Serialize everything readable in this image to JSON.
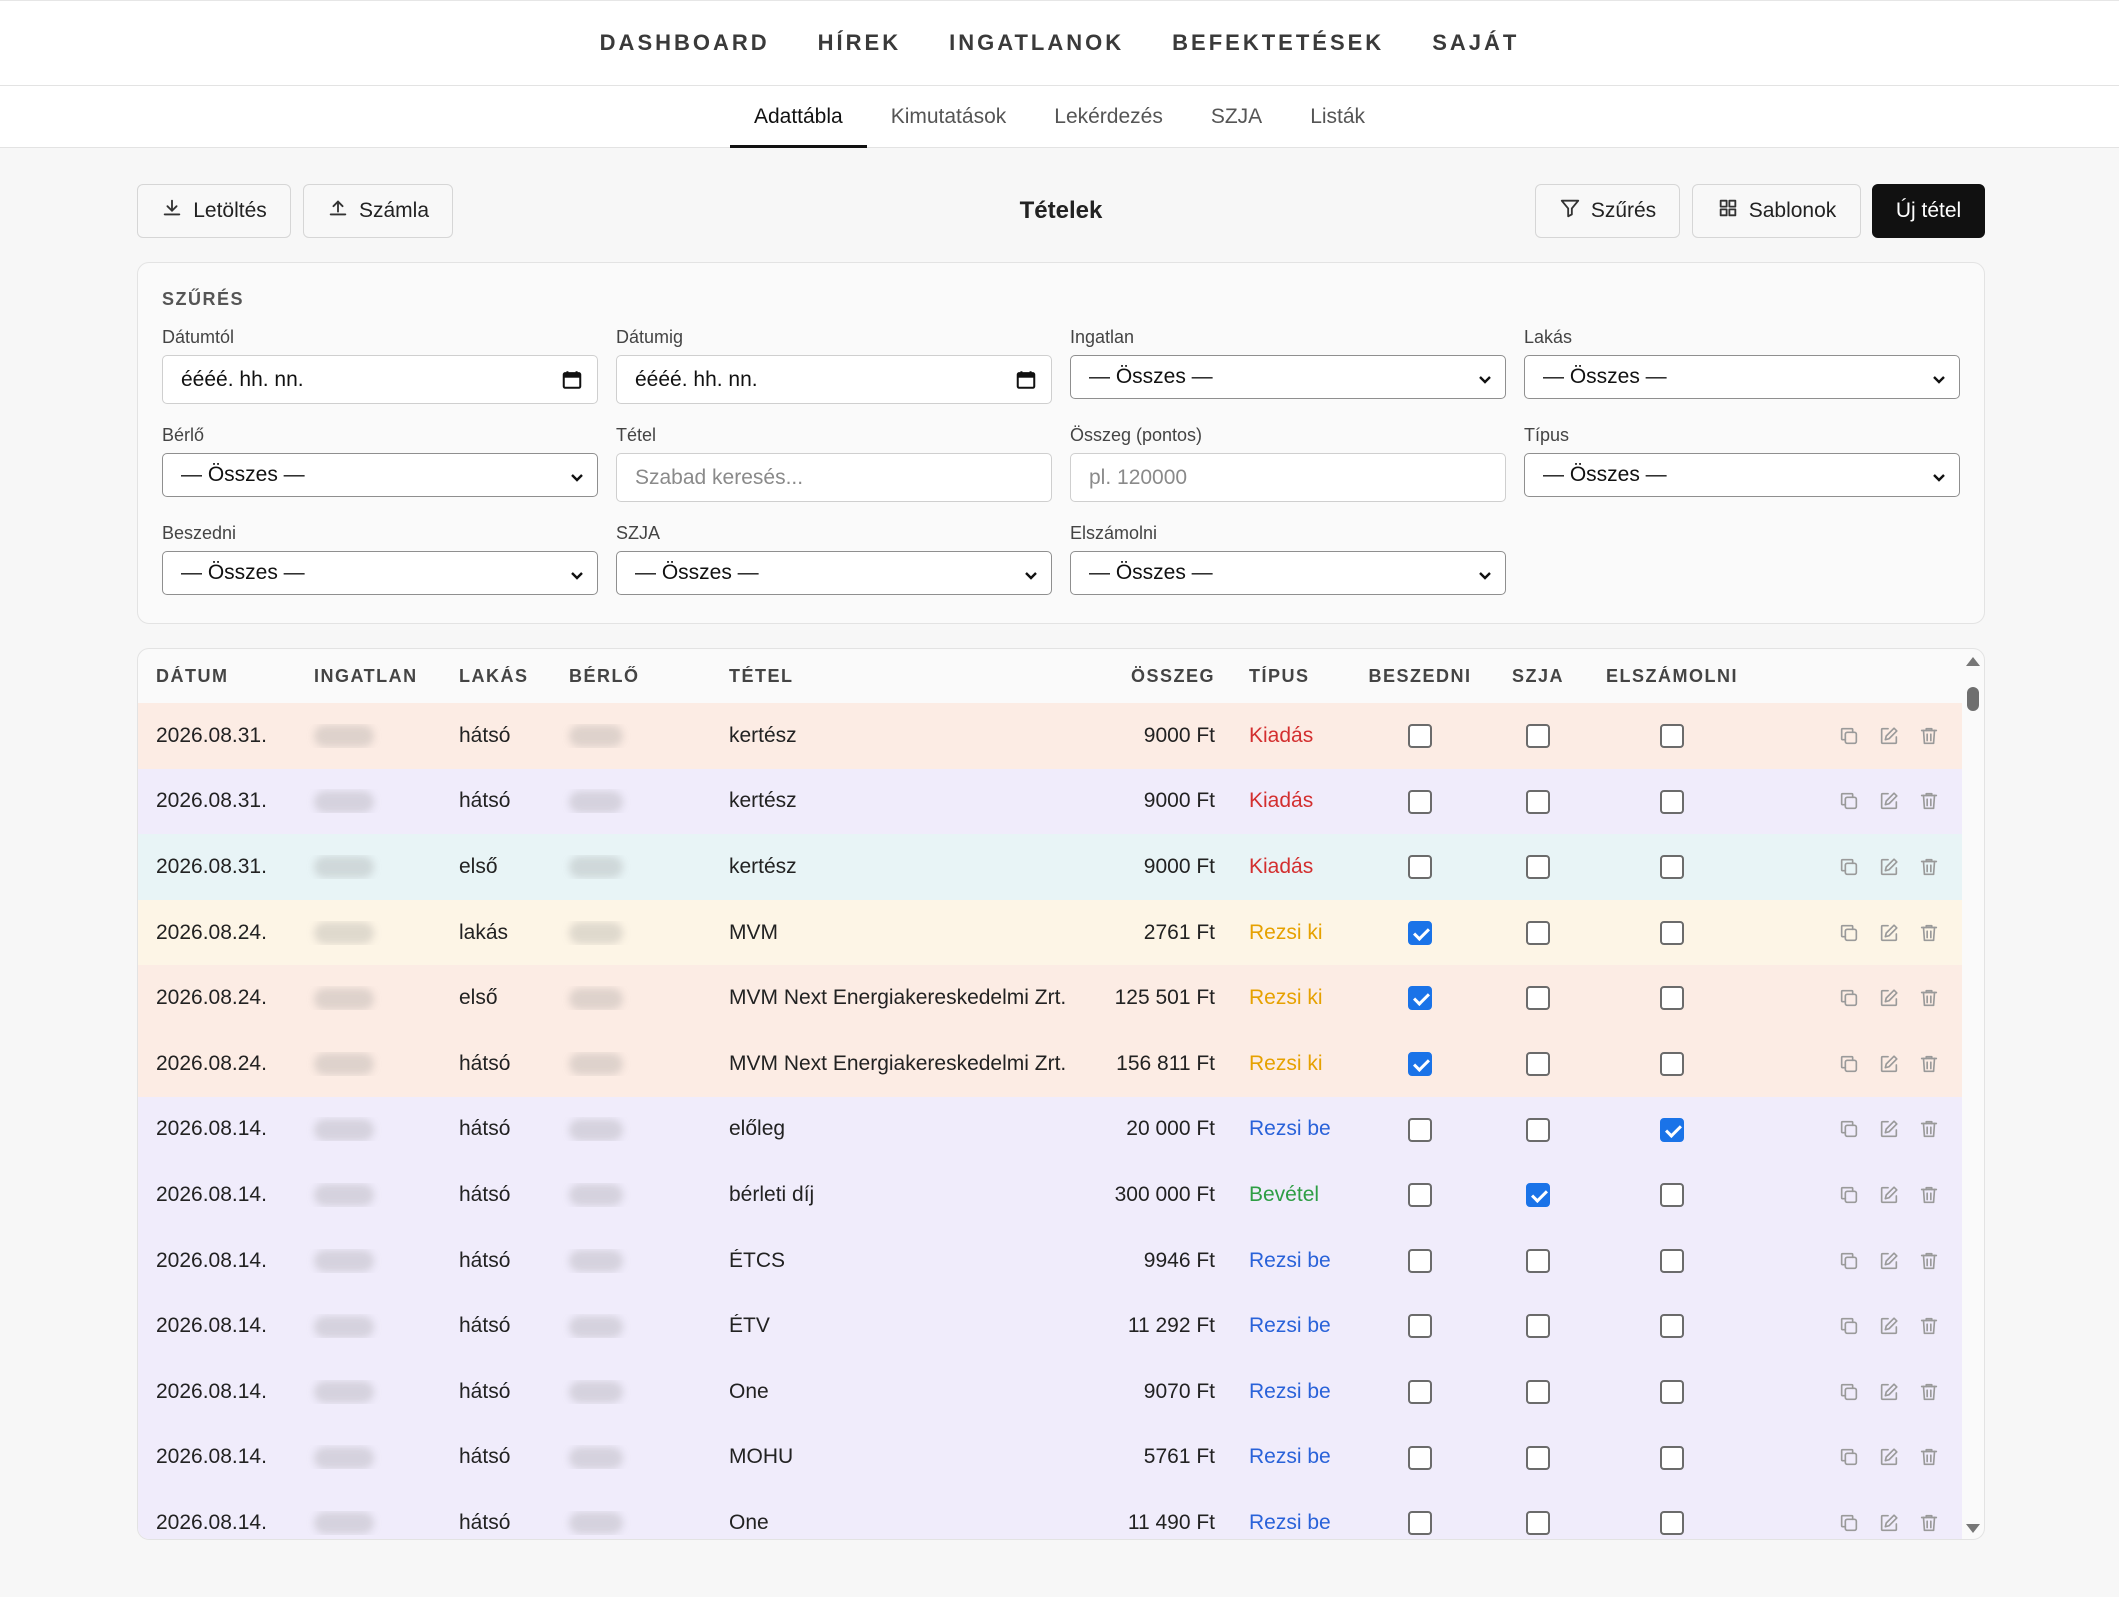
{
  "topnav": [
    "DASHBOARD",
    "HÍREK",
    "INGATLANOK",
    "BEFEKTETÉSEK",
    "SAJÁT"
  ],
  "subtabs": [
    "Adattábla",
    "Kimutatások",
    "Lekérdezés",
    "SZJA",
    "Listák"
  ],
  "active_subtab": "Adattábla",
  "toolbar": {
    "download": "Letöltés",
    "invoice": "Számla",
    "title": "Tételek",
    "filter": "Szűrés",
    "templates": "Sablonok",
    "new_item": "Új tétel"
  },
  "filters": {
    "heading": "SZŰRÉS",
    "fields": [
      {
        "label": "Dátumtól",
        "value": "éééé. hh. nn.",
        "kind": "date"
      },
      {
        "label": "Dátumig",
        "value": "éééé. hh. nn.",
        "kind": "date"
      },
      {
        "label": "Ingatlan",
        "value": "— Összes —",
        "kind": "select"
      },
      {
        "label": "Lakás",
        "value": "— Összes —",
        "kind": "select"
      },
      {
        "label": "Bérlő",
        "value": "— Összes —",
        "kind": "select"
      },
      {
        "label": "Tétel",
        "placeholder": "Szabad keresés...",
        "kind": "text"
      },
      {
        "label": "Összeg (pontos)",
        "placeholder": "pl. 120000",
        "kind": "text"
      },
      {
        "label": "Típus",
        "value": "— Összes —",
        "kind": "select"
      },
      {
        "label": "Beszedni",
        "value": "— Összes —",
        "kind": "select"
      },
      {
        "label": "SZJA",
        "value": "— Összes —",
        "kind": "select"
      },
      {
        "label": "Elszámolni",
        "value": "— Összes —",
        "kind": "select"
      }
    ]
  },
  "table": {
    "columns": [
      "DÁTUM",
      "INGATLAN",
      "LAKÁS",
      "BÉRLŐ",
      "TÉTEL",
      "ÖSSZEG",
      "TÍPUS",
      "BESZEDNI",
      "SZJA",
      "ELSZÁMOLNI"
    ],
    "type_colors": {
      "Kiadás": "#d32f2f",
      "Rezsi ki": "#e6a100",
      "Rezsi be": "#2962d9",
      "Bevétel": "#2e9e44"
    },
    "row_colors": {
      "peach": "#fcece4",
      "lavender": "#f0ecfb",
      "cyan": "#e8f4f6",
      "cream": "#fdf5e6"
    },
    "rows": [
      {
        "date": "2026.08.31.",
        "unit": "hátsó",
        "item": "kertész",
        "amount": "9000 Ft",
        "type": "Kiadás",
        "beszedni": false,
        "szja": false,
        "elszamolni": false,
        "bg": "peach"
      },
      {
        "date": "2026.08.31.",
        "unit": "hátsó",
        "item": "kertész",
        "amount": "9000 Ft",
        "type": "Kiadás",
        "beszedni": false,
        "szja": false,
        "elszamolni": false,
        "bg": "lavender"
      },
      {
        "date": "2026.08.31.",
        "unit": "első",
        "item": "kertész",
        "amount": "9000 Ft",
        "type": "Kiadás",
        "beszedni": false,
        "szja": false,
        "elszamolni": false,
        "bg": "cyan"
      },
      {
        "date": "2026.08.24.",
        "unit": "lakás",
        "item": "MVM",
        "amount": "2761 Ft",
        "type": "Rezsi ki",
        "beszedni": true,
        "szja": false,
        "elszamolni": false,
        "bg": "cream"
      },
      {
        "date": "2026.08.24.",
        "unit": "első",
        "item": "MVM Next Energiakereskedelmi Zrt.",
        "amount": "125 501 Ft",
        "type": "Rezsi ki",
        "beszedni": true,
        "szja": false,
        "elszamolni": false,
        "bg": "peach"
      },
      {
        "date": "2026.08.24.",
        "unit": "hátsó",
        "item": "MVM Next Energiakereskedelmi Zrt.",
        "amount": "156 811 Ft",
        "type": "Rezsi ki",
        "beszedni": true,
        "szja": false,
        "elszamolni": false,
        "bg": "peach"
      },
      {
        "date": "2026.08.14.",
        "unit": "hátsó",
        "item": "előleg",
        "amount": "20 000 Ft",
        "type": "Rezsi be",
        "beszedni": false,
        "szja": false,
        "elszamolni": true,
        "bg": "lavender"
      },
      {
        "date": "2026.08.14.",
        "unit": "hátsó",
        "item": "bérleti díj",
        "amount": "300 000 Ft",
        "type": "Bevétel",
        "beszedni": false,
        "szja": true,
        "elszamolni": false,
        "bg": "lavender"
      },
      {
        "date": "2026.08.14.",
        "unit": "hátsó",
        "item": "ÉTCS",
        "amount": "9946 Ft",
        "type": "Rezsi be",
        "beszedni": false,
        "szja": false,
        "elszamolni": false,
        "bg": "lavender"
      },
      {
        "date": "2026.08.14.",
        "unit": "hátsó",
        "item": "ÉTV",
        "amount": "11 292 Ft",
        "type": "Rezsi be",
        "beszedni": false,
        "szja": false,
        "elszamolni": false,
        "bg": "lavender"
      },
      {
        "date": "2026.08.14.",
        "unit": "hátsó",
        "item": "One",
        "amount": "9070 Ft",
        "type": "Rezsi be",
        "beszedni": false,
        "szja": false,
        "elszamolni": false,
        "bg": "lavender"
      },
      {
        "date": "2026.08.14.",
        "unit": "hátsó",
        "item": "MOHU",
        "amount": "5761 Ft",
        "type": "Rezsi be",
        "beszedni": false,
        "szja": false,
        "elszamolni": false,
        "bg": "lavender"
      },
      {
        "date": "2026.08.14.",
        "unit": "hátsó",
        "item": "One",
        "amount": "11 490 Ft",
        "type": "Rezsi be",
        "beszedni": false,
        "szja": false,
        "elszamolni": false,
        "bg": "lavender"
      }
    ]
  },
  "icons": {
    "download": "download-icon",
    "upload": "upload-icon",
    "filter": "filter-funnel-icon",
    "templates": "grid-icon",
    "copy": "copy-icon",
    "edit": "edit-icon",
    "delete": "trash-icon",
    "calendar": "calendar-icon",
    "chevron": "chevron-down-icon"
  }
}
